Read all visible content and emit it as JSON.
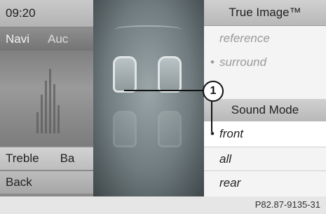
{
  "status": {
    "time": "09:20"
  },
  "menu": {
    "navi": "Navi",
    "audio": "Auc",
    "treble": "Treble",
    "bass": "Ba",
    "back": "Back"
  },
  "true_image": {
    "title": "True Image™",
    "options": [
      {
        "label": "reference",
        "state": "disabled"
      },
      {
        "label": "surround",
        "state": "disabled",
        "marker": "•"
      }
    ]
  },
  "sound_mode": {
    "title": "Sound Mode",
    "options": [
      {
        "label": "front",
        "marker": "•"
      },
      {
        "label": "all"
      },
      {
        "label": "rear"
      }
    ]
  },
  "callout": {
    "number": "1"
  },
  "figure_code": "P82.87-9135-31"
}
